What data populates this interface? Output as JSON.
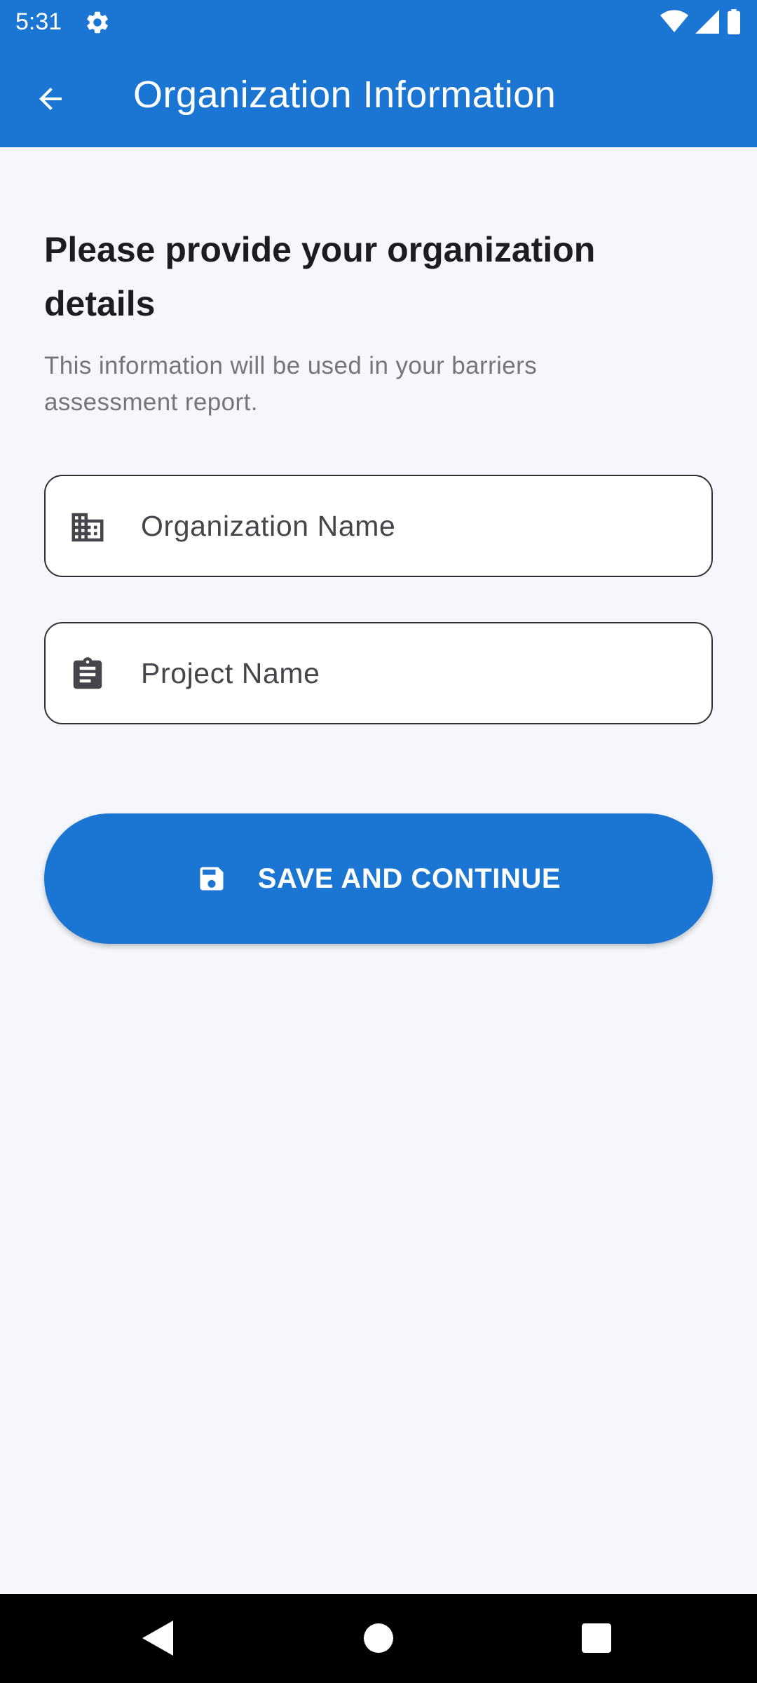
{
  "status_bar": {
    "time": "5:31",
    "icons": [
      "settings-gear-icon",
      "wifi-icon",
      "cellular-signal-icon",
      "battery-icon"
    ]
  },
  "app_bar": {
    "title": "Organization Information",
    "back_icon": "arrow-back-icon"
  },
  "form": {
    "heading": "Please provide your organization details",
    "subtext": "This information will be used in your barriers assessment report.",
    "organization_field": {
      "placeholder": "Organization Name",
      "value": "",
      "icon": "business-building-icon"
    },
    "project_field": {
      "placeholder": "Project Name",
      "value": "",
      "icon": "clipboard-icon"
    },
    "save_button": {
      "label": "SAVE AND CONTINUE",
      "icon": "save-floppy-icon"
    }
  },
  "nav_bar": {
    "buttons": [
      "back-triangle-icon",
      "home-circle-icon",
      "recents-square-icon"
    ]
  },
  "colors": {
    "primary": "#1a76d2",
    "background": "#f6f7fc",
    "text_dark": "#1c1d21",
    "text_muted": "#74767c"
  }
}
